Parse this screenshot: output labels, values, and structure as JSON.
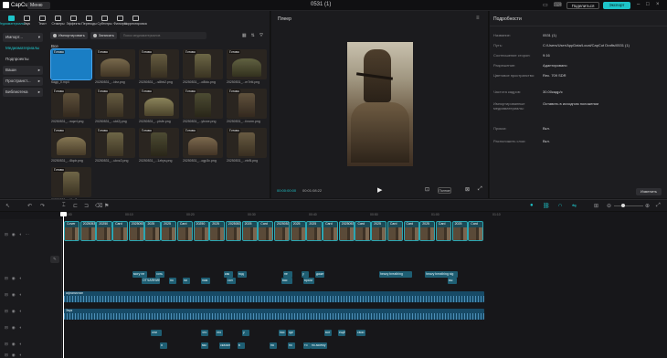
{
  "app": {
    "name": "CapCut",
    "menu": "Меню",
    "project_title": "0531 (1)",
    "share": "Поделиться",
    "export": "Экспорт"
  },
  "toolbar": [
    {
      "label": "Медиаматериалы",
      "active": true
    },
    {
      "label": "Звук"
    },
    {
      "label": "Текст"
    },
    {
      "label": "Стикеры"
    },
    {
      "label": "Эффекты"
    },
    {
      "label": "Переходы"
    },
    {
      "label": "Субтитры"
    },
    {
      "label": "Фильтры"
    },
    {
      "label": "Корректировка"
    }
  ],
  "sidebar": {
    "import": "Импорт...",
    "media": "Медиаматериалы",
    "subprojects": "Подпроекты",
    "yours": "Ваши",
    "spaces": "Пространст...",
    "library": "Библиотека"
  },
  "mediabar": {
    "import_btn": "Импортировать",
    "record_btn": "Записать",
    "search_placeholder": "Поиск медиаматериалов"
  },
  "all_label": "Все",
  "added_tag": "Готово",
  "thumbs": [
    {
      "caption": "Кадр_0.mp4"
    },
    {
      "caption": "20250531_...idsr.png"
    },
    {
      "caption": "20250531_...s8hb2.png"
    },
    {
      "caption": "20250531_...o8ldo.png"
    },
    {
      "caption": "20250531_...m7rfd.png"
    },
    {
      "caption": "20250531_...wqzrl.png"
    },
    {
      "caption": "20250531_...ukt2j.png"
    },
    {
      "caption": "20250531_...pisfe.png"
    },
    {
      "caption": "20250531_...ybxxe.png"
    },
    {
      "caption": "20250531_...fovnm.png"
    },
    {
      "caption": "20250531_...6lqdr.png"
    },
    {
      "caption": "20250531_...ukvz2.png"
    },
    {
      "caption": "20250531_...1zhys.png"
    },
    {
      "caption": "20250531_...ogp3c.png"
    },
    {
      "caption": "20250531_...ntr8i.png"
    },
    {
      "caption": "20250531_...iftm7.png"
    }
  ],
  "player": {
    "title": "Плеер",
    "timecode_current": "00:00:00:00",
    "timecode_total": "00:01:08:22",
    "ratio": "Полное"
  },
  "details": {
    "title": "Подробности",
    "rows": [
      {
        "k": "Название:",
        "v": "0531 (1)"
      },
      {
        "k": "Путь:",
        "v": "C:/Users/User/AppData/Local/CapCut Drafts/0531 (1)"
      },
      {
        "k": "Соотношение сторон:",
        "v": "9:16"
      },
      {
        "k": "Разрешение:",
        "v": "Адаптировано"
      },
      {
        "k": "Цветовое пространство:",
        "v": "Rec. 709 SDR"
      },
      {
        "k": "Частота кадров:",
        "v": "30.00кадр/с"
      },
      {
        "k": "Импортированные медиаматериалы:",
        "v": "Оставить в исходном положении"
      },
      {
        "k": "Прокси:",
        "v": "Вкл."
      },
      {
        "k": "Расположить слои:",
        "v": "Вкл."
      }
    ],
    "edit_btn": "Изменить"
  },
  "ruler": [
    "00:00",
    "00:10",
    "00:20",
    "00:30",
    "00:40",
    "00:50",
    "01:00",
    "01:10"
  ],
  "timeline": {
    "main_clip_labels": [
      "Cover",
      "20250531",
      "20250",
      "Card",
      "2025053",
      "2025",
      "2025",
      "Card",
      "20250",
      "2025",
      "2025053",
      "2025",
      "Card",
      "20250531",
      "2025",
      "2025",
      "Card",
      "20250531",
      "Card",
      "2025",
      "Card",
      "Card",
      "2025",
      "Card",
      "2025",
      "Card"
    ],
    "text_row1": [
      "могу не",
      "хоть",
      "как",
      "под",
      "не",
      "у",
      "даже",
      "heavy breathing",
      "heavy breathing sig"
    ],
    "text_row2": [
      "ОТЧАЯНИЕ",
      "но",
      "ни",
      "нам",
      "сил",
      "вас",
      "враги",
      "вы"
    ],
    "audio1_label": "афганистан",
    "audio2_label": "Звук",
    "text_row3": [
      "они",
      "что",
      "это",
      "у",
      "нас",
      "где",
      "вот",
      "ещё",
      "свои"
    ],
    "text_row4": [
      "я",
      "мы",
      "сказал",
      "в",
      "на",
      "по",
      "то",
      "по-моему"
    ]
  }
}
